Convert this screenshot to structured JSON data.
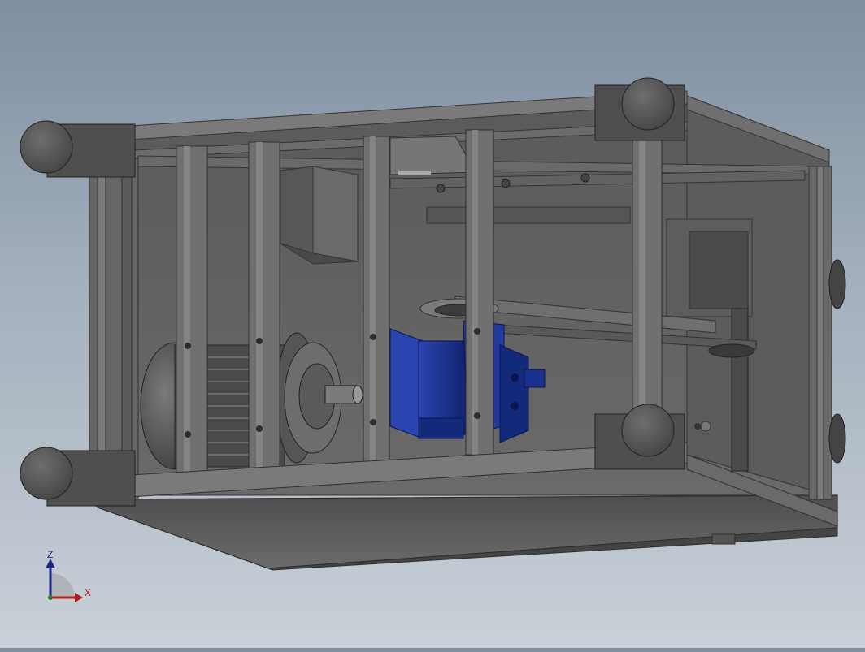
{
  "triad": {
    "z_label": "Z",
    "x_label": "X"
  },
  "colors": {
    "background_top": "#7f8fa1",
    "background_bottom": "#c9d0d8",
    "frame": "#6e6e6e",
    "frame_dark": "#3f3f3f",
    "panel": "#5e5e5e",
    "foot": "#555555",
    "gearbox": "#1a2f8a",
    "gearbox_dark": "#0f1f66",
    "axis_z": "#1a237e",
    "axis_x": "#b71c1c"
  },
  "icons": [
    "cad-model-icon",
    "coordinate-triad-icon"
  ]
}
